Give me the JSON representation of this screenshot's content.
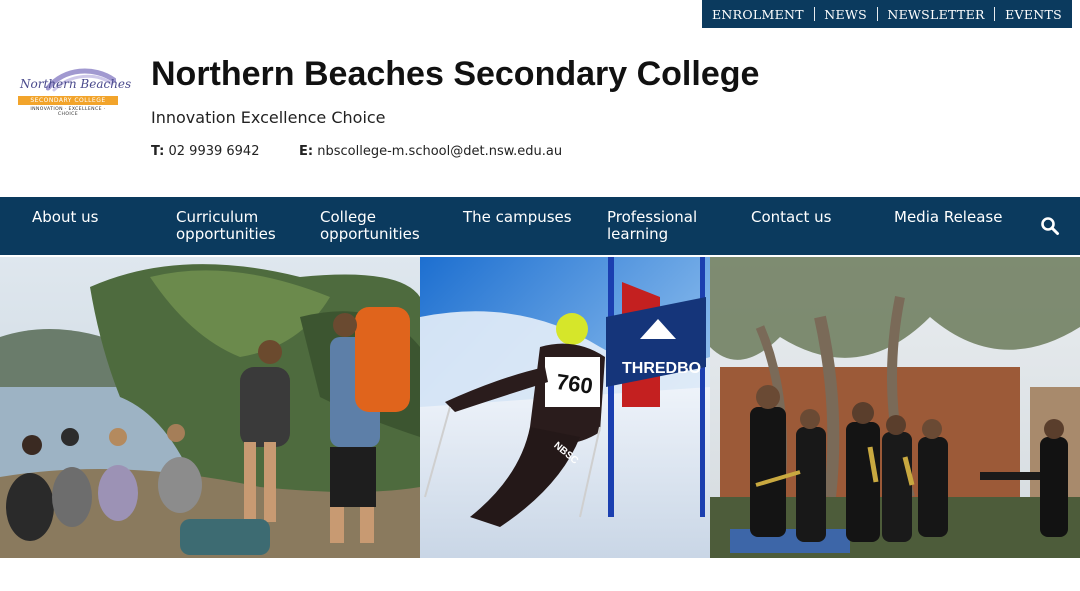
{
  "top_links": [
    "ENROLMENT",
    "NEWS",
    "NEWSLETTER",
    "EVENTS"
  ],
  "logo": {
    "name": "Northern Beaches",
    "band": "SECONDARY COLLEGE",
    "tagline": "INNOVATION · EXCELLENCE · CHOICE"
  },
  "header": {
    "title": "Northern Beaches Secondary College",
    "tagline": "Innovation Excellence Choice",
    "phone_label": "T:",
    "phone": "02 9939 6942",
    "email_label": "E:",
    "email": "nbscollege-m.school@det.nsw.edu.au"
  },
  "nav": {
    "items": [
      [
        "About us"
      ],
      [
        "Curriculum",
        "opportunities"
      ],
      [
        "College",
        "opportunities"
      ],
      [
        "The campuses"
      ],
      [
        "Professional",
        "learning"
      ],
      [
        "Contact us"
      ],
      [
        "Media Release"
      ]
    ]
  },
  "hero": {
    "bib_number": "760",
    "gate_banner": "THREDBO",
    "suit_text": "NBSC"
  },
  "colors": {
    "navy": "#0b3a5e",
    "logo_orange": "#f2a42b",
    "logo_purple": "#4a4a8c"
  },
  "icons": [
    "search-icon"
  ]
}
